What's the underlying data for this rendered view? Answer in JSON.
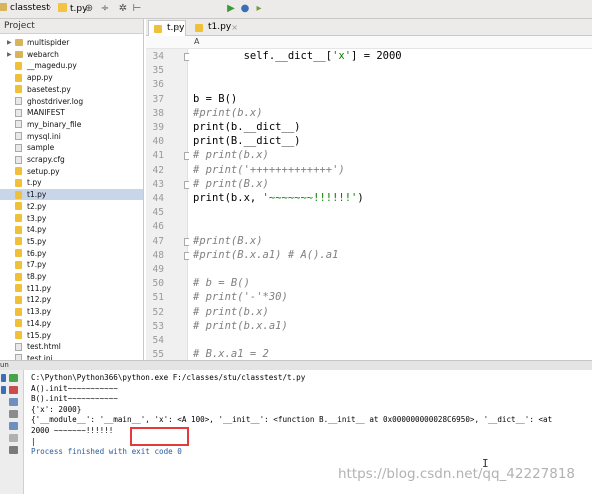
{
  "navbar": {
    "project": "classtest",
    "file": "t.py",
    "icons": [
      "globe-icon",
      "settings-icon",
      "collapse-icon",
      "run-icon",
      "debug-icon"
    ]
  },
  "project_panel": {
    "header": "Project",
    "items": [
      {
        "label": "multispider",
        "kind": "folder",
        "expandable": true
      },
      {
        "label": "webarch",
        "kind": "folder",
        "expandable": true
      },
      {
        "label": "__magedu.py",
        "kind": "py"
      },
      {
        "label": "app.py",
        "kind": "py"
      },
      {
        "label": "basetest.py",
        "kind": "py"
      },
      {
        "label": "ghostdriver.log",
        "kind": "txt"
      },
      {
        "label": "MANIFEST",
        "kind": "txt"
      },
      {
        "label": "my_binary_file",
        "kind": "txt"
      },
      {
        "label": "mysql.ini",
        "kind": "txt"
      },
      {
        "label": "sample",
        "kind": "txt"
      },
      {
        "label": "scrapy.cfg",
        "kind": "txt"
      },
      {
        "label": "setup.py",
        "kind": "py"
      },
      {
        "label": "t.py",
        "kind": "py"
      },
      {
        "label": "t1.py",
        "kind": "py",
        "selected": true
      },
      {
        "label": "t2.py",
        "kind": "py"
      },
      {
        "label": "t3.py",
        "kind": "py"
      },
      {
        "label": "t4.py",
        "kind": "py"
      },
      {
        "label": "t5.py",
        "kind": "py"
      },
      {
        "label": "t6.py",
        "kind": "py"
      },
      {
        "label": "t7.py",
        "kind": "py"
      },
      {
        "label": "t8.py",
        "kind": "py"
      },
      {
        "label": "t11.py",
        "kind": "py"
      },
      {
        "label": "t12.py",
        "kind": "py"
      },
      {
        "label": "t13.py",
        "kind": "py"
      },
      {
        "label": "t14.py",
        "kind": "py"
      },
      {
        "label": "t15.py",
        "kind": "py"
      },
      {
        "label": "test.html",
        "kind": "txt"
      },
      {
        "label": "test.ini",
        "kind": "txt"
      }
    ]
  },
  "editor": {
    "tabs": [
      {
        "label": "t.py",
        "active": true
      },
      {
        "label": "t1.py",
        "active": false
      }
    ],
    "breadcrumb": "A",
    "lines": [
      {
        "n": "34",
        "text": "        self.__dict__['x'] = 2000",
        "comment": false
      },
      {
        "n": "35",
        "text": "",
        "comment": false
      },
      {
        "n": "36",
        "text": "",
        "comment": false
      },
      {
        "n": "37",
        "text": "b = B()",
        "comment": false
      },
      {
        "n": "38",
        "text": "#print(b.x)",
        "comment": true
      },
      {
        "n": "39",
        "text": "print(b.__dict__)",
        "comment": false
      },
      {
        "n": "40",
        "text": "print(B.__dict__)",
        "comment": false
      },
      {
        "n": "41",
        "text": "# print(b.x)",
        "comment": true
      },
      {
        "n": "42",
        "text": "# print('+++++++++++++')",
        "comment": true
      },
      {
        "n": "43",
        "text": "# print(B.x)",
        "comment": true
      },
      {
        "n": "44",
        "text": "print(b.x, '~~~~~~~!!!!!!')",
        "comment": false
      },
      {
        "n": "45",
        "text": "",
        "comment": false
      },
      {
        "n": "46",
        "text": "",
        "comment": false
      },
      {
        "n": "47",
        "text": "#print(B.x)",
        "comment": true
      },
      {
        "n": "48",
        "text": "#print(B.x.a1) # A().a1",
        "comment": true
      },
      {
        "n": "49",
        "text": "",
        "comment": false
      },
      {
        "n": "50",
        "text": "# b = B()",
        "comment": true
      },
      {
        "n": "51",
        "text": "# print('-'*30)",
        "comment": true
      },
      {
        "n": "52",
        "text": "# print(b.x)",
        "comment": true
      },
      {
        "n": "53",
        "text": "# print(b.x.a1)",
        "comment": true
      },
      {
        "n": "54",
        "text": "",
        "comment": false
      },
      {
        "n": "55",
        "text": "# B.x.a1 = 2",
        "comment": true
      }
    ]
  },
  "run_panel": {
    "title": "un",
    "output": [
      "C:\\Python\\Python366\\python.exe F:/classes/stu/classtest/t.py",
      "A().init~~~~~~~~~~~",
      "B().init~~~~~~~~~~~",
      "{'x': 2000}",
      "{'__module__': '__main__', 'x': <A 100>, '__init__': <function B.__init__ at 0x000000000028C6950>, '__dict__': <at",
      "2000 ~~~~~~~!!!!!!",
      "|",
      "Process finished with exit code 0"
    ]
  },
  "watermark": "https://blog.csdn.net/qq_42227818",
  "colors": {
    "comment": "#808080",
    "string": "#008000",
    "selection": "#c8d6ea",
    "highlight_box": "#e33a3a",
    "finish_text": "#2a5b9c"
  }
}
